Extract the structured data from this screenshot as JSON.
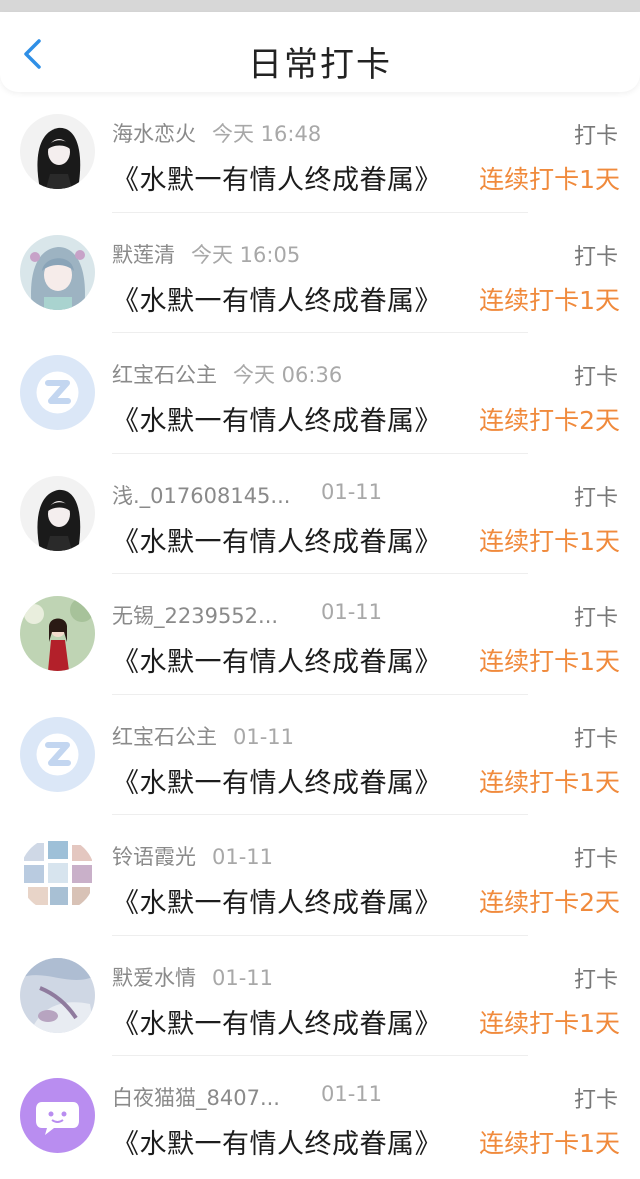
{
  "header": {
    "title": "日常打卡"
  },
  "items": [
    {
      "name": "海水恋火",
      "time": "今天 16:48",
      "action": "打卡",
      "book": "《水默一有情人终成眷属》",
      "streak": "连续打卡1天",
      "avatar": "gothic-girl-avatar"
    },
    {
      "name": "默莲清",
      "time": "今天 16:05",
      "action": "打卡",
      "book": "《水默一有情人终成眷属》",
      "streak": "连续打卡1天",
      "avatar": "anime-girl-avatar"
    },
    {
      "name": "红宝石公主",
      "time": "今天 06:36",
      "action": "打卡",
      "book": "《水默一有情人终成眷属》",
      "streak": "连续打卡2天",
      "avatar": "default-z-avatar"
    },
    {
      "name": "浅._017608145...",
      "time": "01-11",
      "action": "打卡",
      "book": "《水默一有情人终成眷属》",
      "streak": "连续打卡1天",
      "avatar": "gothic-girl-avatar"
    },
    {
      "name": "无锡_2239552...",
      "time": "01-11",
      "action": "打卡",
      "book": "《水默一有情人终成眷属》",
      "streak": "连续打卡1天",
      "avatar": "girl-red-dress-avatar"
    },
    {
      "name": "红宝石公主",
      "time": "01-11",
      "action": "打卡",
      "book": "《水默一有情人终成眷属》",
      "streak": "连续打卡1天",
      "avatar": "default-z-avatar"
    },
    {
      "name": "铃语霞光",
      "time": "01-11",
      "action": "打卡",
      "book": "《水默一有情人终成眷属》",
      "streak": "连续打卡2天",
      "avatar": "collage-avatar"
    },
    {
      "name": "默爱水情",
      "time": "01-11",
      "action": "打卡",
      "book": "《水默一有情人终成眷属》",
      "streak": "连续打卡1天",
      "avatar": "painting-avatar"
    },
    {
      "name": "白夜猫猫_8407...",
      "time": "01-11",
      "action": "打卡",
      "book": "《水默一有情人终成眷属》",
      "streak": "连续打卡1天",
      "avatar": "chat-bubble-avatar"
    }
  ],
  "colors": {
    "accent": "#f08a3c",
    "back": "#2f8fe6",
    "default_avatar": "#dbe7f7",
    "chat_avatar": "#b98df0"
  }
}
